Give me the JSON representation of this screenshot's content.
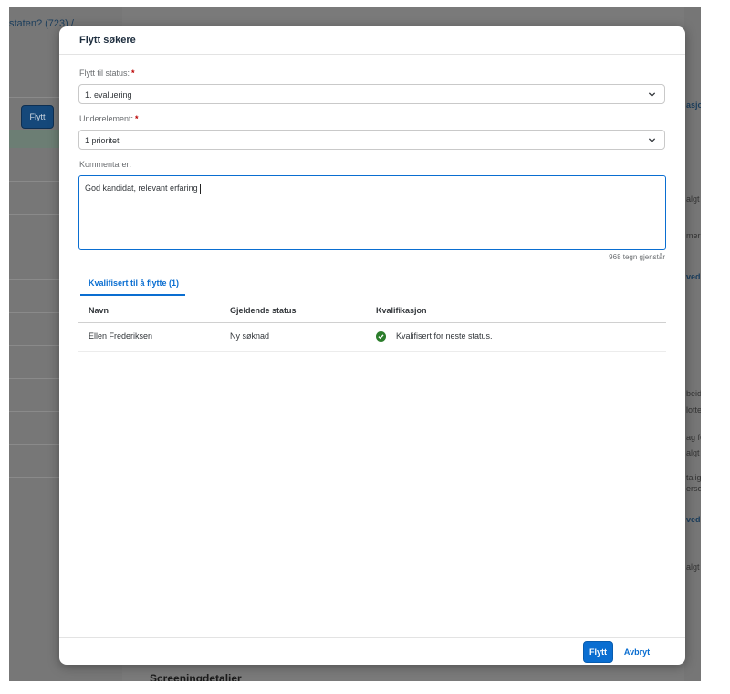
{
  "background": {
    "breadcrumb": "staten? (723) /",
    "move_button": "Flytt",
    "right_fragments": [
      "asjo",
      "algt",
      "mer",
      "vedl",
      "beid",
      "lotte",
      "ag fo",
      "algt",
      "talig",
      "erso",
      "vedl",
      "algt"
    ],
    "footer_heading": "Screeningdetaljer"
  },
  "dialog": {
    "title": "Flytt søkere",
    "status_label": "Flytt til status:",
    "status_value": "1. evaluering",
    "subelement_label": "Underelement:",
    "subelement_value": "1 prioritet",
    "required_mark": "*",
    "comments_label": "Kommentarer:",
    "comments_value": "God kandidat, relevant erfaring",
    "char_counter": "968 tegn gjenstår",
    "tab_label": "Kvalifisert til å flytte (1)",
    "table": {
      "columns": [
        "Navn",
        "Gjeldende status",
        "Kvalifikasjon"
      ],
      "rows": [
        {
          "name": "Ellen Frederiksen",
          "status": "Ny søknad",
          "qualification": "Kvalifisert for neste status."
        }
      ]
    },
    "buttons": {
      "primary": "Flytt",
      "cancel": "Avbryt"
    }
  },
  "colors": {
    "accent": "#0a6ed1",
    "required": "#bb0000",
    "success": "#2b7d2b",
    "overlay": "#7a7a7a"
  }
}
